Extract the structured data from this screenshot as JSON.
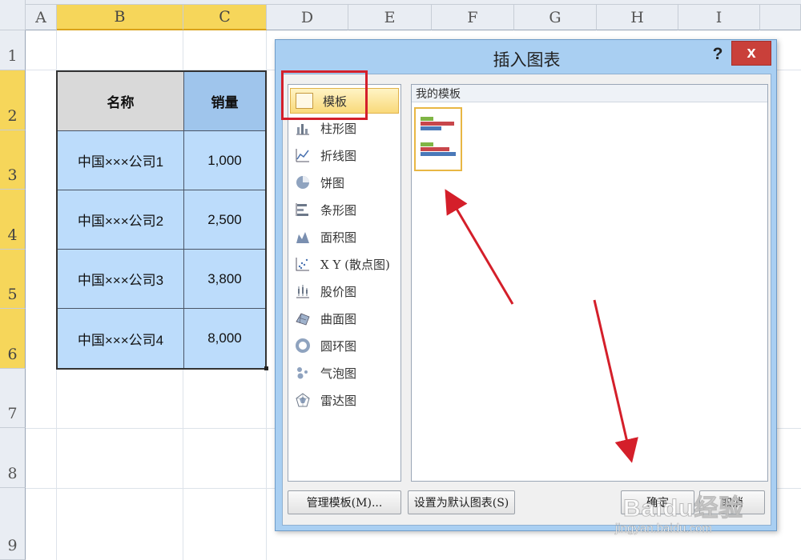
{
  "spreadsheet": {
    "columns": [
      "A",
      "B",
      "C",
      "D",
      "E",
      "F",
      "G",
      "H",
      "I"
    ],
    "rows": [
      "1",
      "2",
      "3",
      "4",
      "5",
      "6",
      "7",
      "8",
      "9"
    ],
    "table": {
      "headers": [
        "名称",
        "销量"
      ],
      "rows": [
        [
          "中国×××公司1",
          "1,000"
        ],
        [
          "中国×××公司2",
          "2,500"
        ],
        [
          "中国×××公司3",
          "3,800"
        ],
        [
          "中国×××公司4",
          "8,000"
        ]
      ]
    }
  },
  "dialog": {
    "title": "插入图表",
    "help_label": "?",
    "close_label": "x",
    "categories": [
      {
        "label": "模板",
        "icon": "folder-icon"
      },
      {
        "label": "柱形图",
        "icon": "column-chart-icon"
      },
      {
        "label": "折线图",
        "icon": "line-chart-icon"
      },
      {
        "label": "饼图",
        "icon": "pie-chart-icon"
      },
      {
        "label": "条形图",
        "icon": "bar-chart-icon"
      },
      {
        "label": "面积图",
        "icon": "area-chart-icon"
      },
      {
        "label": "X Y (散点图)",
        "icon": "scatter-chart-icon"
      },
      {
        "label": "股价图",
        "icon": "stock-chart-icon"
      },
      {
        "label": "曲面图",
        "icon": "surface-chart-icon"
      },
      {
        "label": "圆环图",
        "icon": "doughnut-chart-icon"
      },
      {
        "label": "气泡图",
        "icon": "bubble-chart-icon"
      },
      {
        "label": "雷达图",
        "icon": "radar-chart-icon"
      }
    ],
    "template_header": "我的模板",
    "manage_templates_label": "管理模板(M)...",
    "set_default_label": "设置为默认图表(S)",
    "ok_label": "确定",
    "cancel_label": "取消"
  },
  "watermark": {
    "logo": "Baidu经验",
    "url": "jingyan.baidu.com"
  },
  "colors": {
    "annotation_red": "#d41f2a",
    "selected_header": "#f6d65a",
    "table_fill": "#bcdcfb",
    "close_red": "#c9403a"
  }
}
